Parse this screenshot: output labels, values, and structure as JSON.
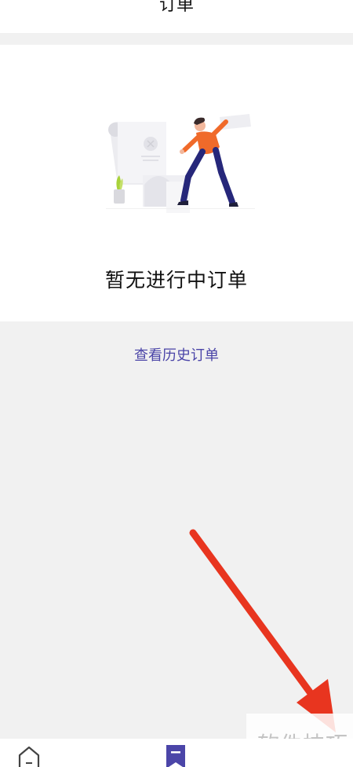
{
  "header": {
    "title": "订单"
  },
  "empty_state": {
    "message": "暂无进行中订单",
    "illustration": "empty-orders-illustration"
  },
  "history_link": {
    "label": "查看历史订单"
  },
  "watermark": {
    "text": "软件技巧"
  },
  "tabbar": {
    "items": [
      {
        "icon": "home-icon",
        "active": false
      },
      {
        "icon": "orders-bookmark-icon",
        "active": true
      }
    ]
  },
  "annotation": {
    "type": "red-arrow-pointing-to-bottom-right"
  },
  "colors": {
    "accent": "#4b45a8",
    "arrow": "#e8351f",
    "background": "#f1f1f1"
  }
}
